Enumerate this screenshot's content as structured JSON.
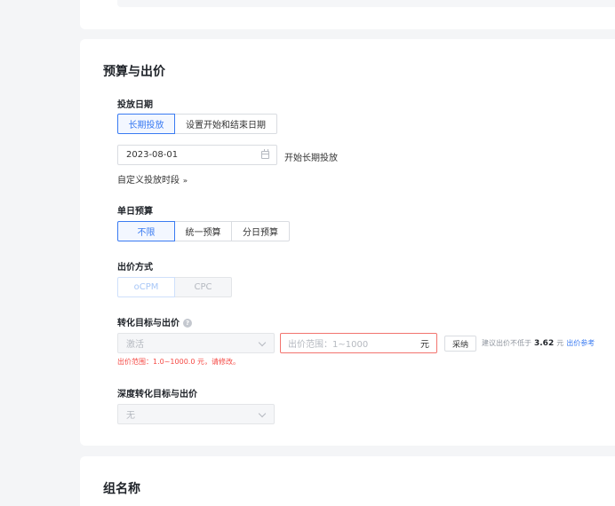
{
  "budget_section": {
    "title": "预算与出价",
    "schedule": {
      "label": "投放日期",
      "options": [
        "长期投放",
        "设置开始和结束日期"
      ],
      "selected": "长期投放",
      "start_date": "2023-08-01",
      "start_note": "开始长期投放",
      "custom_period_link": "自定义投放时段"
    },
    "daily_budget": {
      "label": "单日预算",
      "options": [
        "不限",
        "统一预算",
        "分日预算"
      ],
      "selected": "不限"
    },
    "bid_method": {
      "label": "出价方式",
      "options": [
        "oCPM",
        "CPC"
      ],
      "selected": "oCPM"
    },
    "conversion": {
      "label": "转化目标与出价",
      "help_icon": "question-icon",
      "target_value": "激活",
      "price_placeholder": "出价范围：1~1000",
      "price_unit": "元",
      "adopt_button": "采纳",
      "suggestion_prefix": "建议出价不低于",
      "suggestion_value": "3.62",
      "suggestion_unit": "元",
      "reference_link": "出价参考",
      "error_text": "出价范围：1.0~1000.0 元，请修改。"
    },
    "deep_conversion": {
      "label": "深度转化目标与出价",
      "value": "无"
    }
  },
  "group_section": {
    "title": "组名称"
  },
  "colors": {
    "accent": "#3a7bf2",
    "error": "#f54a45",
    "background": "#f4f5f7"
  }
}
